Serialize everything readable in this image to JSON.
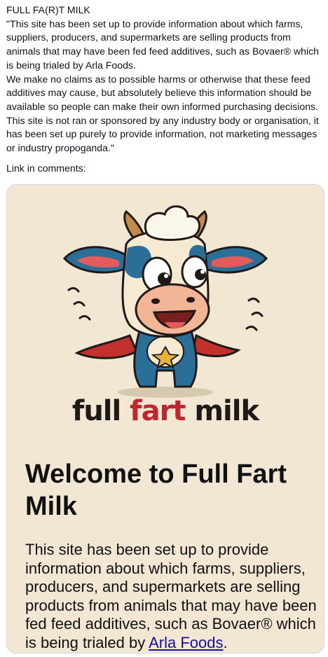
{
  "post": {
    "heading": "FULL FA(R)T MILK",
    "paragraph_1": "\"This site has been set up to provide information about which farms, suppliers, producers, and supermarkets are selling products from animals that may have been fed feed additives, such as Bovaer® which is being trialed by Arla Foods.",
    "paragraph_2": "We make no claims as to possible harms or otherwise that these feed additives may cause, but absolutely believe this information should be available so people can make their own informed purchasing decisions. This site is not ran or sponsored by any industry body or organisation, it has been set up purely to provide information, not marketing messages or industry propoganda.\"",
    "link_note": "Link in comments:"
  },
  "card": {
    "logo_word_1": "full",
    "logo_word_2": "fart",
    "logo_word_3": "milk",
    "title": "Welcome to Full Fart Milk",
    "body_text": "This site has been set up to provide information about which farms, suppliers, producers, and supermarkets are selling products from animals that may have been fed feed additives, such as Bovaer® which is being trialed by ",
    "body_link": "Arla Foods",
    "body_end": ".",
    "background_color": "#f1e7d3",
    "accent_color": "#c1252d"
  }
}
